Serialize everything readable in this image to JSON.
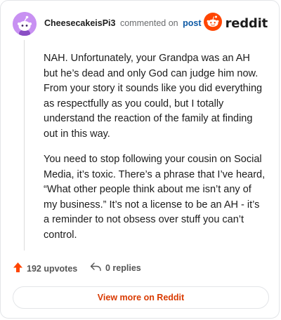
{
  "header": {
    "username": "CheesecakeisPi3",
    "action": "commented on",
    "link_text": "post",
    "brand": "reddit"
  },
  "comment": {
    "paragraphs": [
      "NAH. Unfortunately, your Grandpa was an AH but he’s dead and only God can judge him now. From your story it sounds like you did everything as respectfully as you could, but I totally understand the reaction of the family at finding out in this way.",
      "You need to stop following your cousin on Social Media, it’s toxic. There’s a phrase that I’ve heard, “What other people think about me isn’t any of my business.” It’s not a license to be an AH - it’s a reminder to not obsess over stuff you can’t control."
    ]
  },
  "footer": {
    "upvotes": "192 upvotes",
    "replies": "0 replies"
  },
  "cta": {
    "label": "View more on Reddit"
  },
  "colors": {
    "brand_orange": "#ff4500",
    "link_blue": "#0e5aa5",
    "cta_orange": "#d93a00",
    "avatar_bg": "#c891f2"
  },
  "icons": {
    "avatar": "snoo-avatar-icon",
    "brand": "reddit-logo-icon",
    "upvote": "upvote-arrow-icon",
    "reply": "reply-arrow-icon"
  }
}
